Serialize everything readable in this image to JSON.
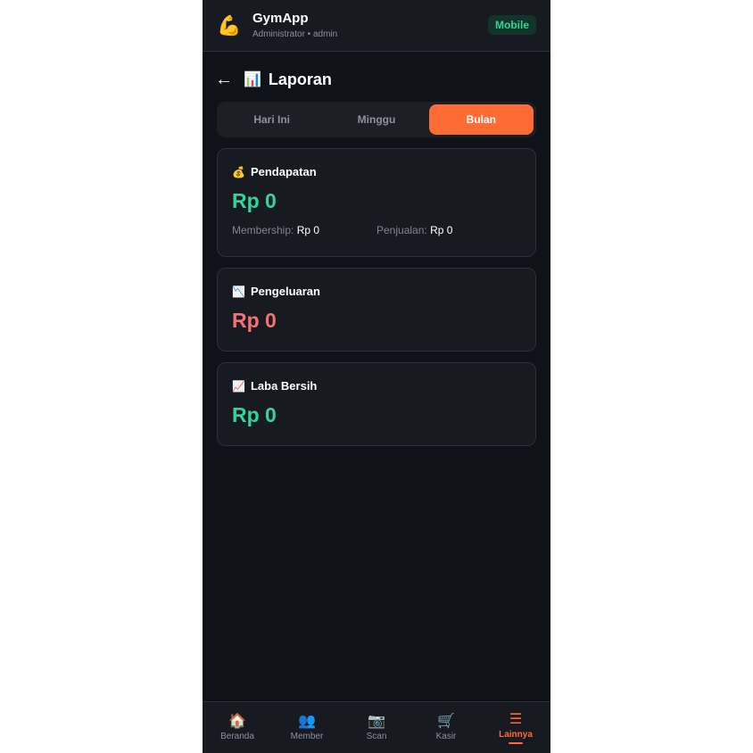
{
  "header": {
    "logo_icon": "💪",
    "app_name": "GymApp",
    "subtitle": "Administrator • admin",
    "badge": "Mobile"
  },
  "page": {
    "back_icon": "←",
    "title_icon": "📊",
    "title": "Laporan"
  },
  "tabs": [
    {
      "label": "Hari Ini",
      "active": false
    },
    {
      "label": "Minggu",
      "active": false
    },
    {
      "label": "Bulan",
      "active": true
    }
  ],
  "cards": {
    "income": {
      "icon": "💰",
      "title": "Pendapatan",
      "amount": "Rp 0",
      "membership_label": "Membership:",
      "membership_value": "Rp 0",
      "sales_label": "Penjualan:",
      "sales_value": "Rp 0"
    },
    "expense": {
      "icon": "📉",
      "title": "Pengeluaran",
      "amount": "Rp 0"
    },
    "profit": {
      "icon": "📈",
      "title": "Laba Bersih",
      "amount": "Rp 0"
    }
  },
  "nav": [
    {
      "icon": "🏠",
      "label": "Beranda"
    },
    {
      "icon": "👥",
      "label": "Member"
    },
    {
      "icon": "📷",
      "label": "Scan"
    },
    {
      "icon": "🛒",
      "label": "Kasir"
    },
    {
      "icon": "☰",
      "label": "Lainnya",
      "active": true
    }
  ],
  "colors": {
    "accent": "#ff6b35",
    "positive": "#34d399",
    "negative": "#f87171",
    "background": "#0f1218"
  }
}
